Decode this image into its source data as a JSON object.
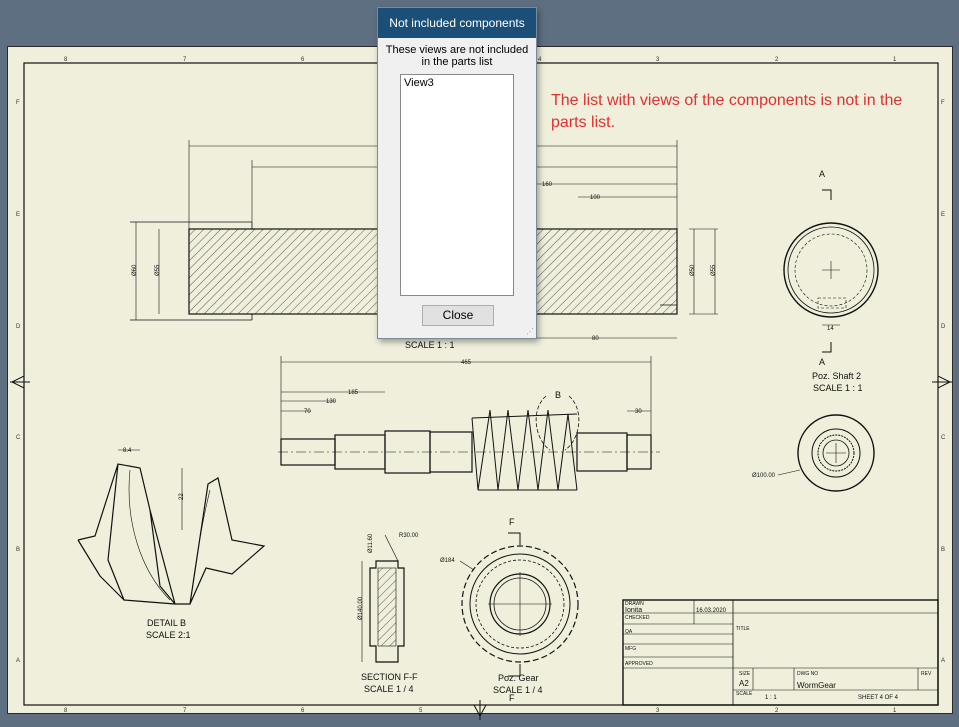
{
  "dialog": {
    "title": "Not included components",
    "message": "These views are not included in the parts list",
    "list_items": [
      "View3"
    ],
    "close_label": "Close"
  },
  "annotation": {
    "text": "The list with views of the components is not in the parts list."
  },
  "drawing": {
    "section_labels": {
      "top_view_scale": "SCALE 1 : 1"
    },
    "dimensions": {
      "d_160": "160",
      "d_100": "100",
      "d_80": "80",
      "d_465": "465",
      "d_185": "185",
      "d_130": "130",
      "d_70": "70",
      "d_30": "30",
      "d_8_4": "8.4",
      "d_22": "22",
      "d_14": "14",
      "dia_60": "Ø60",
      "dia_55_left": "Ø55",
      "dia_50": "Ø50",
      "dia_55_right": "Ø55",
      "dia_100": "Ø100.00",
      "dia_184": "Ø184",
      "dia_11": "Ø11.60",
      "dia_140": "Ø140.00",
      "r30": "R30.00"
    },
    "views": {
      "shaft2_label": "Poz. Shaft 2",
      "shaft2_scale": "SCALE 1 : 1",
      "section_a_top": "A",
      "section_a_bottom": "A",
      "detail_b_marker": "B",
      "detail_label": "DETAIL  B",
      "detail_scale": "SCALE 2:1",
      "section_ff_label": "SECTION F-F",
      "section_ff_scale": "SCALE 1 / 4",
      "gear_label": "Poz. Gear",
      "gear_scale": "SCALE 1 / 4",
      "f_top": "F",
      "f_bottom": "F"
    },
    "border_numbers": [
      "8",
      "7",
      "6",
      "5",
      "4",
      "3",
      "2",
      "1"
    ],
    "border_letters": [
      "F",
      "E",
      "D",
      "C",
      "B",
      "A"
    ],
    "title_block": {
      "drawn_label": "DRAWN",
      "drawn_name": "Ionita",
      "drawn_date": "16.03.2020",
      "checked_label": "CHECKED",
      "qa_label": "QA",
      "mfg_label": "MFG",
      "approved_label": "APPROVED",
      "title_label": "TITLE",
      "size_label": "SIZE",
      "size_value": "A2",
      "dwg_no_label": "DWG NO",
      "dwg_no_value": "WormGear",
      "rev_label": "REV",
      "scale_label": "SCALE",
      "scale_value": "1 : 1",
      "sheet_value": "SHEET 4  OF 4"
    }
  }
}
